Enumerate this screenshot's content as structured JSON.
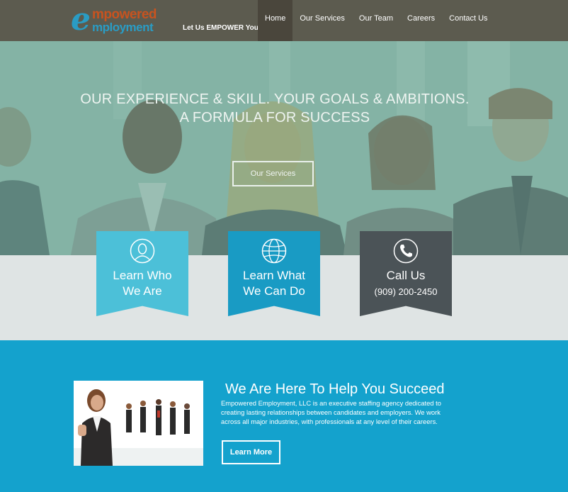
{
  "header": {
    "logo_line1": "mpowered",
    "logo_line2": "mployment",
    "logo_letter": "e",
    "tagline": "Let Us EMPOWER You!",
    "nav": [
      {
        "label": "Home",
        "active": true
      },
      {
        "label": "Our Services",
        "active": false
      },
      {
        "label": "Our Team",
        "active": false
      },
      {
        "label": "Careers",
        "active": false
      },
      {
        "label": "Contact Us",
        "active": false
      }
    ]
  },
  "hero": {
    "title_line1": "OUR EXPERIENCE & SKILL. YOUR GOALS & AMBITIONS.",
    "title_line2": "A FORMULA FOR SUCCESS",
    "button_label": "Our Services"
  },
  "features": [
    {
      "icon": "user-icon",
      "line1": "Learn Who",
      "line2": "We Are",
      "color": "#4cc0d8"
    },
    {
      "icon": "globe-icon",
      "line1": "Learn What",
      "line2": "We Can Do",
      "color": "#199bc4"
    },
    {
      "icon": "phone-icon",
      "line1": "Call Us",
      "line2": "(909) 200-2450",
      "color": "#4b5357"
    }
  ],
  "about": {
    "title": "We Are Here To Help You Succeed",
    "body": "Empowered Employment, LLC is an executive staffing agency dedicated to creating lasting relationships between candidates and employers. We work across all major industries, with professionals at any level of their careers.",
    "button_label": "Learn More"
  },
  "colors": {
    "header_bg": "#5c5b4f",
    "section_blue": "#14a2cd",
    "light_band": "#dfe4e4"
  }
}
